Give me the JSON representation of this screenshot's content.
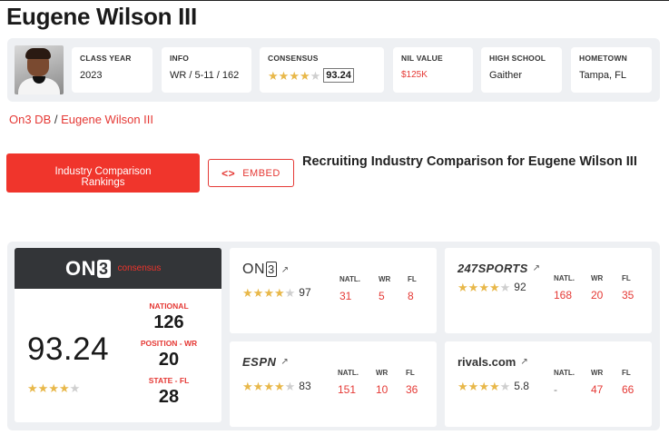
{
  "player": {
    "name": "Eugene Wilson III"
  },
  "info_cards": [
    {
      "label": "CLASS YEAR",
      "value": "2023"
    },
    {
      "label": "INFO",
      "value": "WR / 5-11 / 162"
    },
    {
      "label": "CONSENSUS",
      "stars": 4,
      "score": "93.24"
    },
    {
      "label": "NIL VALUE",
      "value": "$125K"
    },
    {
      "label": "HIGH SCHOOL",
      "value": "Gaither"
    },
    {
      "label": "HOMETOWN",
      "value": "Tampa, FL"
    }
  ],
  "breadcrumb": {
    "root": "On3 DB",
    "separator": "/",
    "current": "Eugene Wilson III"
  },
  "actions": {
    "compare_label_line1": "Industry Comparison",
    "compare_label_line2": "Rankings",
    "embed_icon": "<>",
    "embed_label": "EMBED"
  },
  "section_title": "Recruiting Industry Comparison for Eugene Wilson III",
  "consensus": {
    "brand": "ON",
    "brand_num": "3",
    "tag": "consensus",
    "score": "93.24",
    "stars": 4,
    "ranks": [
      {
        "label": "NATIONAL",
        "value": "126"
      },
      {
        "label": "POSITION - WR",
        "value": "20"
      },
      {
        "label": "STATE - FL",
        "value": "28"
      }
    ]
  },
  "services": [
    {
      "name": "On3",
      "brand": "ON",
      "brand_num": "3",
      "stars": 4,
      "score": "97",
      "cols": [
        {
          "label": "NATL.",
          "value": "31"
        },
        {
          "label": "WR",
          "value": "5"
        },
        {
          "label": "FL",
          "value": "8"
        }
      ]
    },
    {
      "name": "247Sports",
      "brand": "247SPORTS",
      "stars": 4,
      "score": "92",
      "cols": [
        {
          "label": "NATL.",
          "value": "168"
        },
        {
          "label": "WR",
          "value": "20"
        },
        {
          "label": "FL",
          "value": "35"
        }
      ]
    },
    {
      "name": "ESPN",
      "brand": "ESPN",
      "stars": 4,
      "score": "83",
      "cols": [
        {
          "label": "NATL.",
          "value": "151"
        },
        {
          "label": "WR",
          "value": "10"
        },
        {
          "label": "FL",
          "value": "36"
        }
      ]
    },
    {
      "name": "Rivals",
      "brand": "rivals.com",
      "stars": 4,
      "score": "5.8",
      "cols": [
        {
          "label": "NATL.",
          "value": "-"
        },
        {
          "label": "WR",
          "value": "47"
        },
        {
          "label": "FL",
          "value": "66"
        }
      ]
    }
  ],
  "colors": {
    "accent": "#f0352c",
    "star": "#e8b84a",
    "header_dark": "#333538",
    "panel_bg": "#eef0f3"
  },
  "icons": {
    "external_link": "external-link-icon",
    "star": "star-icon",
    "code": "code-icon"
  }
}
